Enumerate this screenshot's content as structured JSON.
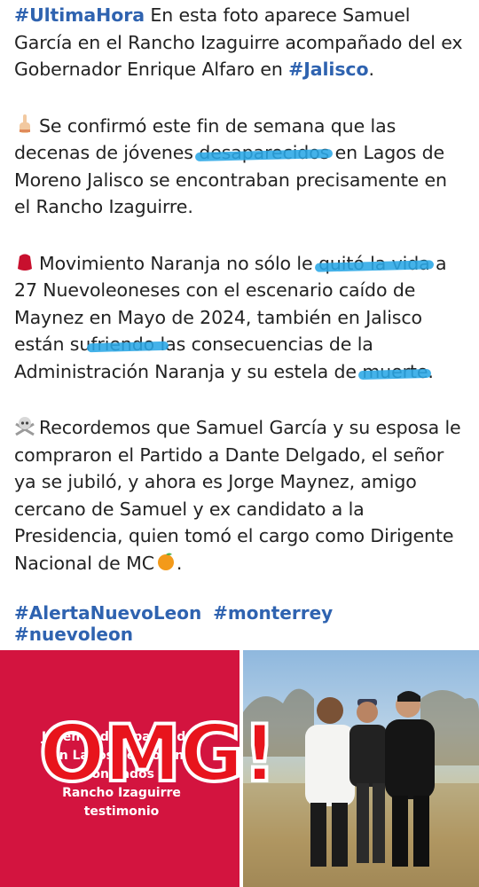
{
  "post": {
    "p1": {
      "hashtag": "#UltimaHora",
      "text_a": " En esta foto aparece Samuel García en el Rancho Izaguirre acompañado del ex Gobernador Enrique Alfaro en ",
      "hashtag2": "#Jalisco",
      "text_b": "."
    },
    "p2": {
      "icon": "pointing-finger-icon",
      "text_a": "Se confirmó este fin de semana que las decenas de jóvenes ",
      "highlight": "desaparecidos",
      "text_b": " en Lagos de Moreno Jalisco se encontraban precisamente en el Rancho Izaguirre."
    },
    "p3": {
      "icon": "red-drop-icon",
      "text_a": "Movimiento Naranja no sólo le ",
      "highlight1": "quitó la vida",
      "text_b": " a 27 Nuevoleoneses con el escenario caído de Maynez en Mayo de 2024, también en Jalisco están su",
      "highlight2": "friendo l",
      "text_c": "as consecuencias de la Administración Naranja y su estela de ",
      "highlight3": "muerte",
      "text_d": "."
    },
    "p4": {
      "icon": "skull-crossbones-icon",
      "text_a": "Recordemos que Samuel García y su esposa le compraron el Partido a Dante Delgado, el señor ya se jubiló, y ahora es Jorge Maynez, amigo cercano de Samuel y ex candidato a la Presidencia, quien tomó el cargo como Dirigente Nacional de MC",
      "icon_end": "orange-icon",
      "text_b": "."
    },
    "hashtags": [
      "#AlertaNuevoLeon",
      "#monterrey",
      "#nuevoleon"
    ]
  },
  "image": {
    "caption_lines": [
      "Jóvenes desaparecidos",
      "en Lagos de Moreno",
      "encontrados en",
      "Rancho Izaguirre",
      "testimonio"
    ],
    "overlay_text": "OMG!",
    "panel_color": "#d3143f",
    "overlay_color": "#e8141c",
    "link_color": "#2f63b0",
    "scribble_color": "#2aa7e6"
  }
}
